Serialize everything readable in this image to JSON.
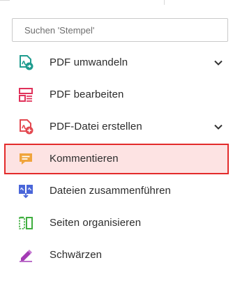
{
  "search": {
    "placeholder": "Suchen 'Stempel'",
    "value": ""
  },
  "menu": {
    "items": [
      {
        "label": "PDF umwandeln",
        "icon": "pdf-convert-icon",
        "has_chevron": true,
        "selected": false
      },
      {
        "label": "PDF bearbeiten",
        "icon": "edit-pdf-icon",
        "has_chevron": false,
        "selected": false
      },
      {
        "label": "PDF-Datei erstellen",
        "icon": "create-pdf-icon",
        "has_chevron": true,
        "selected": false
      },
      {
        "label": "Kommentieren",
        "icon": "comment-icon",
        "has_chevron": false,
        "selected": true
      },
      {
        "label": "Dateien zusammenführen",
        "icon": "combine-files-icon",
        "has_chevron": false,
        "selected": false
      },
      {
        "label": "Seiten organisieren",
        "icon": "organize-pages-icon",
        "has_chevron": false,
        "selected": false
      },
      {
        "label": "Schwärzen",
        "icon": "redact-icon",
        "has_chevron": false,
        "selected": false
      }
    ]
  },
  "colors": {
    "selection_border": "#e32b2b",
    "selection_fill": "#fde3e3",
    "teal": "#1f9c8f",
    "pink": "#e0315a",
    "red": "#e34850",
    "orange": "#f0a43c",
    "blue": "#4a66d9",
    "green": "#3fae3f",
    "purple": "#a43bb5"
  }
}
